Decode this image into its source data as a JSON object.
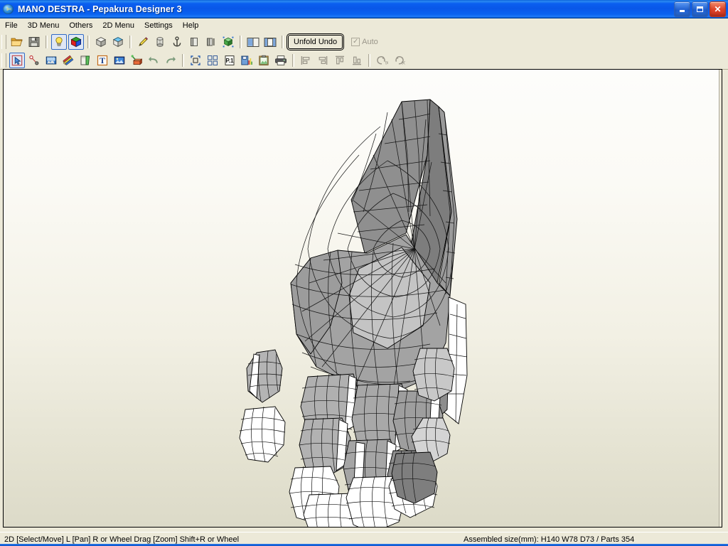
{
  "window": {
    "title": "MANO DESTRA - Pepakura Designer 3",
    "icon": "pepakura-globe-icon",
    "buttons": {
      "minimize": "minimize-button",
      "maximize": "maximize-button",
      "close": "close-button",
      "close_glyph": "✕"
    }
  },
  "menubar": {
    "items": [
      {
        "label": "File"
      },
      {
        "label": "3D Menu"
      },
      {
        "label": "Others"
      },
      {
        "label": "2D Menu"
      },
      {
        "label": "Settings"
      },
      {
        "label": "Help"
      }
    ]
  },
  "toolbar_row1": {
    "items": [
      {
        "name": "open-file-icon",
        "type": "icon",
        "pressed": false
      },
      {
        "name": "save-file-icon",
        "type": "icon",
        "pressed": false
      },
      {
        "name": "separator",
        "type": "sep"
      },
      {
        "name": "lightbulb-icon",
        "type": "icon",
        "pressed": true
      },
      {
        "name": "rgb-cube-icon",
        "type": "icon",
        "pressed": true
      },
      {
        "name": "separator",
        "type": "sep"
      },
      {
        "name": "cube-icon",
        "type": "icon",
        "pressed": false
      },
      {
        "name": "open-box-icon",
        "type": "icon",
        "pressed": false
      },
      {
        "name": "separator",
        "type": "sep"
      },
      {
        "name": "pencil-icon",
        "type": "icon",
        "pressed": false
      },
      {
        "name": "cylinder-icon",
        "type": "icon",
        "pressed": false
      },
      {
        "name": "anchor-icon",
        "type": "icon",
        "pressed": false
      },
      {
        "name": "panel-icon",
        "type": "icon",
        "pressed": false
      },
      {
        "name": "split-panel-icon",
        "type": "icon",
        "pressed": false
      },
      {
        "name": "green-cube-icon",
        "type": "icon",
        "pressed": false
      },
      {
        "name": "separator",
        "type": "sep"
      },
      {
        "name": "layout-vertical-split-icon",
        "type": "icon",
        "pressed": false
      },
      {
        "name": "layout-center-panel-icon",
        "type": "icon",
        "pressed": false
      },
      {
        "name": "separator",
        "type": "sep"
      }
    ],
    "unfold_undo_label": "Unfold Undo",
    "auto_label": "Auto",
    "auto_checked": true,
    "auto_enabled": false
  },
  "toolbar_row2": {
    "items": [
      {
        "name": "select-move-tool-icon",
        "type": "icon",
        "pressed": true
      },
      {
        "name": "edge-connect-tool-icon",
        "type": "icon",
        "pressed": false
      },
      {
        "name": "texture-tool-icon",
        "type": "icon",
        "pressed": false
      },
      {
        "name": "color-pencils-icon",
        "type": "icon",
        "pressed": false
      },
      {
        "name": "flap-tool-icon",
        "type": "icon",
        "pressed": false
      },
      {
        "name": "text-tool-icon",
        "type": "icon",
        "pressed": false
      },
      {
        "name": "image-tool-icon",
        "type": "icon",
        "pressed": false
      },
      {
        "name": "paint-stamp-icon",
        "type": "icon",
        "pressed": false
      },
      {
        "name": "undo-icon",
        "type": "icon",
        "pressed": false
      },
      {
        "name": "redo-icon",
        "type": "icon",
        "pressed": false
      },
      {
        "name": "separator",
        "type": "sep"
      },
      {
        "name": "select-all-icon",
        "type": "icon",
        "pressed": false
      },
      {
        "name": "arrange-parts-icon",
        "type": "icon",
        "pressed": false
      },
      {
        "name": "page-one-icon",
        "type": "icon",
        "pressed": false
      },
      {
        "name": "save-chart-icon",
        "type": "icon",
        "pressed": false
      },
      {
        "name": "clipboard-icon",
        "type": "icon",
        "pressed": false
      },
      {
        "name": "print-icon",
        "type": "icon",
        "pressed": false
      },
      {
        "name": "separator",
        "type": "sep"
      },
      {
        "name": "align-left-icon",
        "type": "icon",
        "pressed": false,
        "disabled": true
      },
      {
        "name": "align-right-icon",
        "type": "icon",
        "pressed": false,
        "disabled": true
      },
      {
        "name": "align-top-icon",
        "type": "icon",
        "pressed": false,
        "disabled": true
      },
      {
        "name": "align-bottom-icon",
        "type": "icon",
        "pressed": false,
        "disabled": true
      },
      {
        "name": "separator",
        "type": "sep"
      },
      {
        "name": "rotate-left-90-icon",
        "type": "icon",
        "pressed": false,
        "disabled": true
      },
      {
        "name": "rotate-right-90-icon",
        "type": "icon",
        "pressed": false,
        "disabled": true
      }
    ]
  },
  "statusbar": {
    "left": "2D [Select/Move] L [Pan] R or Wheel Drag [Zoom] Shift+R or Wheel",
    "right": "Assembled size(mm): H140 W78 D73 / Parts 354"
  },
  "canvas": {
    "name": "unfold-2d-canvas",
    "background_top": "#fdfdfb",
    "background_bottom": "#dcdac8",
    "model_description": "Papercraft unfolded mesh of a right-hand gauntlet: large curved palm/knuckle shell with pointed cuff, plus fourteen cylindrical finger segment parts",
    "mesh_line_color": "#000000",
    "fill_shades": [
      "#ffffff",
      "#f2f2f2",
      "#dcdcdc",
      "#c8c8c8",
      "#b4b4b4",
      "#a0a0a0",
      "#8c8c8c"
    ]
  }
}
